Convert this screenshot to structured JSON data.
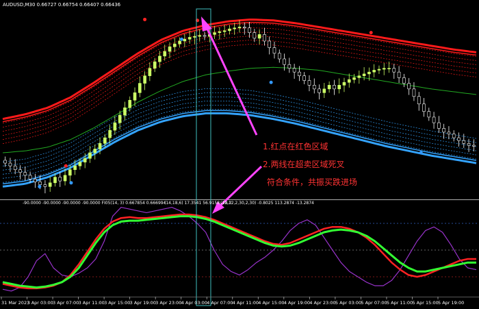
{
  "window": {
    "symbol_line": "AUDUSD,M30  0.66727 0.66754 0.66407 0.66436"
  },
  "indicator_header": {
    "left": "-90.0000 -90.0000 -90.0000 -90.0000  FI05(14, 3) 0.667854 0.666994",
    "right": "(14,18,6) 17.3541 56.9158 -28.2",
    "right2": "(11,12,2,30,2,30) -0.8025 113.2874 -13.2874"
  },
  "annotations": {
    "line1": "1.红点在红色区域",
    "line2": "2.两线在超卖区域死叉",
    "line3": "符合条件，共振买跌进场"
  },
  "colors": {
    "background": "#000000",
    "bull_candle": "#ccff66",
    "bear_candle": "#ffffff",
    "upper_band": "#ff1a1a",
    "lower_band": "#33a3ff",
    "middle_line": "#22aa22",
    "osc_green": "#33ff33",
    "osc_red": "#ff2222",
    "osc_purple": "#9933cc",
    "arrow": "#ff44ff",
    "annotation_text": "#ff3333",
    "crosshair": "#40c0c0",
    "red_dot": "#ff2222",
    "blue_dot": "#3399ff"
  },
  "chart_data": [
    {
      "type": "candlestick",
      "title": "AUDUSD,M30",
      "x_tick_labels": [
        "31 Mar 2023",
        "3 Apr 03:00",
        "3 Apr 07:00",
        "3 Apr 11:00",
        "3 Apr 15:00",
        "3 Apr 19:00",
        "3 Apr 23:00",
        "4 Apr 03:00",
        "4 Apr 07:00",
        "4 Apr 11:00",
        "4 Apr 15:00",
        "4 Apr 19:00",
        "4 Apr 23:00",
        "5 Apr 03:00",
        "5 Apr 07:00",
        "5 Apr 11:00",
        "5 Apr 15:00",
        "5 Apr 19:00"
      ],
      "price_range": [
        0.659,
        0.679
      ],
      "close": [
        0.6625,
        0.6622,
        0.6618,
        0.6615,
        0.6612,
        0.6608,
        0.6605,
        0.6602,
        0.66,
        0.6604,
        0.661,
        0.6606,
        0.6612,
        0.6618,
        0.6622,
        0.6626,
        0.663,
        0.6636,
        0.664,
        0.6646,
        0.6652,
        0.666,
        0.6668,
        0.6676,
        0.6684,
        0.6692,
        0.67,
        0.671,
        0.6718,
        0.6726,
        0.6733,
        0.6739,
        0.6744,
        0.6749,
        0.6752,
        0.6755,
        0.6757,
        0.6759,
        0.676,
        0.6761,
        0.676,
        0.6762,
        0.6764,
        0.6765,
        0.6766,
        0.6768,
        0.6769,
        0.677,
        0.6769,
        0.6764,
        0.6758,
        0.6762,
        0.6755,
        0.6748,
        0.6742,
        0.6736,
        0.673,
        0.6726,
        0.6722,
        0.6718,
        0.6713,
        0.6708,
        0.6704,
        0.67,
        0.6704,
        0.6708,
        0.6704,
        0.6708,
        0.6711,
        0.6714,
        0.6716,
        0.6718,
        0.672,
        0.6722,
        0.6724,
        0.6725,
        0.6726,
        0.6726,
        0.6722,
        0.6716,
        0.671,
        0.6704,
        0.6696,
        0.6688,
        0.668,
        0.6674,
        0.6668,
        0.6662,
        0.6658,
        0.6656,
        0.6652,
        0.6649,
        0.6646,
        0.6644,
        0.6643
      ],
      "series": [
        {
          "name": "upper_band",
          "values": [
            0.6672,
            0.6677,
            0.6684,
            0.6695,
            0.671,
            0.6726,
            0.6742,
            0.6756,
            0.6766,
            0.6772,
            0.6776,
            0.6778,
            0.6777,
            0.6774,
            0.677,
            0.6766,
            0.6762,
            0.6758,
            0.6754,
            0.675,
            0.6746,
            0.6743
          ]
        },
        {
          "name": "middle",
          "values": [
            0.6636,
            0.6638,
            0.6642,
            0.665,
            0.6662,
            0.6676,
            0.669,
            0.6702,
            0.6712,
            0.6719,
            0.6723,
            0.6726,
            0.6727,
            0.6726,
            0.6724,
            0.672,
            0.6716,
            0.6712,
            0.6708,
            0.6704,
            0.6701,
            0.6698
          ]
        },
        {
          "name": "lower_band",
          "values": [
            0.66,
            0.6603,
            0.661,
            0.662,
            0.6634,
            0.6648,
            0.666,
            0.6669,
            0.6675,
            0.6678,
            0.6678,
            0.6676,
            0.6672,
            0.6667,
            0.6661,
            0.6655,
            0.6649,
            0.6643,
            0.6638,
            0.6633,
            0.6629,
            0.6625
          ]
        }
      ],
      "red_dots": [
        [
          24,
          0.6622
        ],
        [
          54,
          0.6778
        ],
        [
          74,
          0.6777
        ],
        [
          140,
          0.6764
        ]
      ],
      "blue_dots": [
        [
          14,
          0.66
        ],
        [
          26,
          0.6604
        ],
        [
          68,
          0.6757
        ],
        [
          102,
          0.6711
        ],
        [
          159,
          0.6636
        ]
      ]
    },
    {
      "type": "line",
      "title": "FI05(14, 3)",
      "y_range": [
        0,
        100
      ],
      "levels": [
        80,
        50,
        20
      ],
      "series": [
        {
          "name": "green",
          "values": [
            14,
            12,
            10,
            9,
            8,
            9,
            11,
            14,
            20,
            30,
            44,
            58,
            70,
            78,
            82,
            83,
            83,
            84,
            85,
            86,
            87,
            88,
            88,
            87,
            85,
            82,
            78,
            74,
            70,
            66,
            62,
            58,
            55,
            54,
            55,
            58,
            62,
            66,
            70,
            72,
            73,
            72,
            70,
            66,
            60,
            52,
            44,
            36,
            30,
            26,
            26,
            28,
            30,
            32,
            34,
            36,
            36
          ]
        },
        {
          "name": "red",
          "values": [
            12,
            10,
            8,
            7,
            7,
            8,
            10,
            14,
            22,
            34,
            48,
            62,
            74,
            82,
            86,
            87,
            86,
            86,
            87,
            88,
            89,
            90,
            90,
            89,
            87,
            84,
            80,
            76,
            72,
            68,
            64,
            60,
            57,
            56,
            58,
            62,
            66,
            70,
            74,
            76,
            76,
            74,
            70,
            64,
            56,
            46,
            36,
            28,
            22,
            20,
            22,
            26,
            30,
            34,
            38,
            40,
            40
          ]
        },
        {
          "name": "purple",
          "values": [
            6,
            4,
            8,
            20,
            38,
            46,
            30,
            22,
            20,
            24,
            30,
            40,
            60,
            88,
            98,
            96,
            94,
            92,
            94,
            96,
            98,
            94,
            88,
            80,
            70,
            50,
            34,
            26,
            22,
            28,
            36,
            42,
            50,
            60,
            72,
            80,
            84,
            78,
            64,
            50,
            36,
            26,
            20,
            14,
            10,
            10,
            16,
            28,
            44,
            60,
            72,
            76,
            70,
            56,
            40,
            30,
            28
          ]
        }
      ]
    }
  ]
}
